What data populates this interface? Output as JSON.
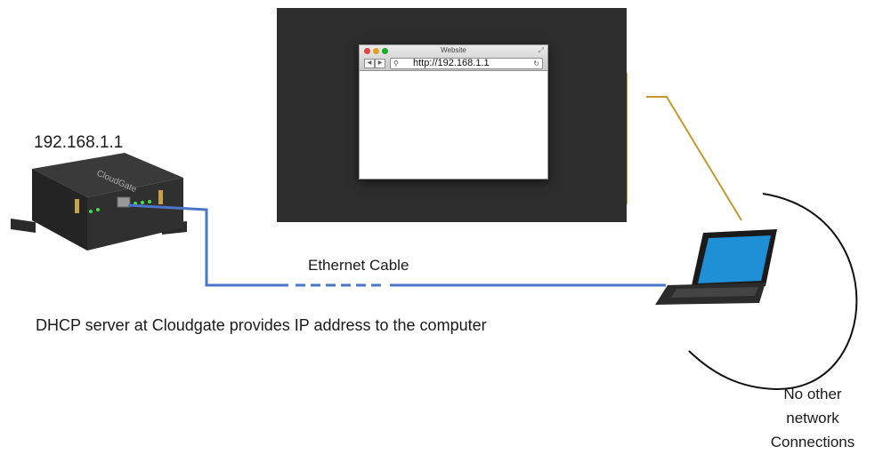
{
  "router": {
    "ip": "192.168.1.1",
    "brand_text": "CloudGate"
  },
  "cable": {
    "label": "Ethernet Cable"
  },
  "caption": "DHCP server at Cloudgate provides IP address to the computer",
  "browser": {
    "title": "Website",
    "url": "http://192.168.1.1"
  },
  "computer": {
    "note_lines": [
      "No other",
      "network",
      "Connections"
    ]
  },
  "colors": {
    "cable": "#4a76c8",
    "callout": "#c39a2a",
    "screen_bg": "#2d2d2d",
    "laptop_screen": "#1f8fd6"
  },
  "icons": {
    "router": "router-device-icon",
    "laptop": "laptop-icon"
  }
}
